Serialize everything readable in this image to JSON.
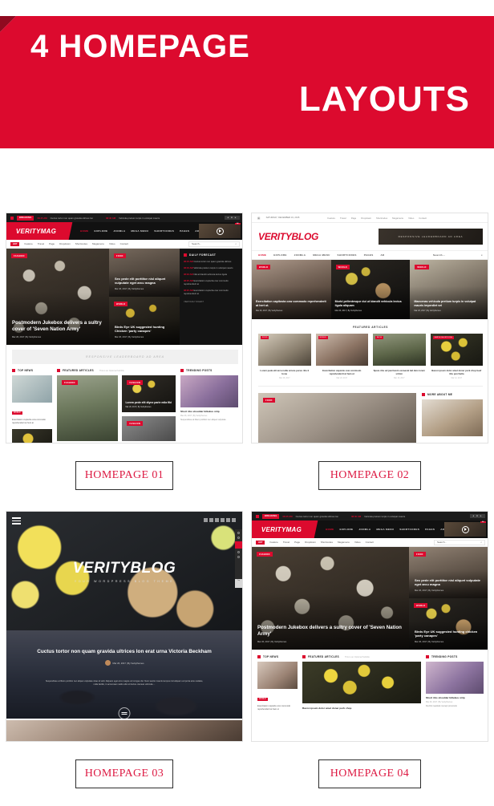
{
  "banner": {
    "line1": "4 HOMEPAGE",
    "line2": "LAYOUTS",
    "bg_color": "#dc0a2e",
    "fold_color": "#8f0a20",
    "text_color": "#ffffff"
  },
  "captions": {
    "hp1": "HOMEPAGE 01",
    "hp2": "HOMEPAGE 02",
    "hp3": "HOMEPAGE 03",
    "hp4": "HOMEPAGE 04"
  },
  "accent_color": "#dc0a2e",
  "homepage_01": {
    "breaking": {
      "badge": "BREAKING",
      "item1_time": "08:45 AM",
      "item1_text": "Cuctus tortor non quam gravida ultrices lon",
      "item2_time": "08:40 AM",
      "item2_text": "Vehicula pretium turpis in volutpat mauris",
      "arrows": "◄ ■ ►"
    },
    "logo": "VERITYMAG",
    "nav": [
      "HOME",
      "EXPLORE",
      "JOOMLA",
      "MEGA MENU",
      "SHORTCODES",
      "PAGES",
      "AD"
    ],
    "ad_tag": "AD",
    "subnav": {
      "hot": "HOT",
      "items": [
        "Feature",
        "Travel",
        "Page",
        "Dropdown",
        "Shortcodes",
        "Megamenu",
        "Video",
        "Contact"
      ],
      "search_placeholder": "Search...",
      "search_icon": "search-icon"
    },
    "hero": {
      "category": "FASHION",
      "title": "Postmodern Jukebox delivers a sultry cover of 'Seven Nation Army'",
      "meta": "Mar 26, 2017  |  By Veritythemes"
    },
    "hero_card_top": {
      "category": "FOOD",
      "title": "Sec pede elit porttitor nisl aliquet vulputate eget arcu magna",
      "meta": "Mar 26, 2017  |  By Veritythemes"
    },
    "hero_card_bottom": {
      "category": "WORLD",
      "title": "Birds Eye UK suggested hunting Chicken 'party canapes'",
      "meta": "Mar 26, 2017  |  By Veritythemes"
    },
    "sidebar_widget": {
      "title": "DAILY FORECAST",
      "items": [
        {
          "time": "08:45 AM",
          "text": "Cuctus tortor non quam gravida ultrices"
        },
        {
          "time": "08:40 AM",
          "text": "Vehicula pretium turpis in volutpat mauris"
        },
        {
          "time": "08:32 AM",
          "text": "Nisl at blandit vehicula lectus ligula"
        },
        {
          "time": "08:25 AM",
          "text": "Exercitation cupiscita cow commodo reprehenderit at"
        },
        {
          "time": "08:20 AM",
          "text": "Exercitation cupiscita cow commodo reprehenderit at"
        }
      ],
      "footer": "VIEW DAILY DIGEST"
    },
    "leaderboard": "RESPONSIVE LEADERBOARD AD AREA",
    "sections": {
      "top_news": "TOP NEWS",
      "featured": "FEATURED ARTICLES",
      "featured_sub": "This is an Optional Subtitle",
      "trending": "TRENDING POSTS"
    },
    "top_news_card": {
      "tag": "WORLD",
      "text": "Exercitation cupiscita cow commodo reprehenderit at hunt at"
    },
    "featured_cards": [
      {
        "tag": "FASHION",
        "title": "",
        "meta": ""
      },
      {
        "tag": "FASHION",
        "title": "Lorem pede elit diyne parie mila fiki",
        "meta": "Mar 26, 2017  |  By Veritythemes"
      },
      {
        "tag": "FASHION",
        "title": "",
        "meta": ""
      }
    ],
    "trending_card": {
      "title": "Short ribs shoulder biltekus strip",
      "meta": "Mar 26, 2017  |  By Veritythemes",
      "body": "Suspendisse at libero porttitor nec aliquet vulputate"
    }
  },
  "homepage_02": {
    "topbar": {
      "date": "SATURDAY, DECEMBER 19, 2015",
      "calendar_icon": "calendar-icon",
      "links": [
        "Feature",
        "Travel",
        "Page",
        "Dropdown",
        "Shortcodes",
        "Megamenu",
        "Video",
        "Contact"
      ]
    },
    "logo": "VERITYBLOG",
    "ad_area": "RESPONSIVE LEADERBOARD AD AREA",
    "nav": [
      "HOME",
      "EXPLORE",
      "JOOMLA",
      "MEGA MENU",
      "SHORTCODES",
      "PAGES",
      "AD"
    ],
    "search_placeholder": "Search...",
    "hero_tiles": [
      {
        "tag": "WORLD",
        "title": "Exercitation capitosta cow commodo reprehenderit at hert ut.",
        "meta": "Mar 26, 2017 | By Veritythemes"
      },
      {
        "tag": "WORLD",
        "title": "Morbi pellentesque dui ut blandit vehicula lectus ligula aliquam",
        "meta": "Mar 26, 2017 | By Veritythemes"
      },
      {
        "tag": "WORLD",
        "title": "Maecenas vehicula pretium turpis in volutpat mauris imperdiet vel",
        "meta": "Mar 26, 2017 | By Veritythemes"
      }
    ],
    "featured_heading": "FEATURED ARTICLES",
    "featured": [
      {
        "tag": "FOOD",
        "title": "Lorem pede elit arcu nulla ornare purus ribs li bone",
        "meta": "Mar 26, 2017"
      },
      {
        "tag": "WORLD",
        "title": "Exercitation capsicle cow commodo reprehenderit at ham ut",
        "meta": "Mar 23, 2017"
      },
      {
        "tag": "BLOG",
        "title": "Spare ribs ad jowl kevin occaecat tail duis lorem sirloin",
        "meta": "Mar 16, 2017"
      },
      {
        "tag": "SIMPLE SHORTCODE",
        "title": "Bacon ipsum dolor amet doner pork chop beef ribs porchetta",
        "meta": "Mar 12, 2017"
      }
    ],
    "lower_post_tag": "FOOD",
    "about_heading": "MORE ABOUT ME"
  },
  "homepage_03": {
    "menu_icon": "hamburger-menu-icon",
    "social_icons": [
      "facebook-icon",
      "twitter-icon",
      "google-plus-icon",
      "instagram-icon",
      "pinterest-icon",
      "rss-icon"
    ],
    "brand": "VERITYBLOG",
    "tagline": "YOUR WORDPRESS BLOG THEME",
    "rail_icons": [
      "dot-indicator",
      "dot-indicator",
      "pencil-icon",
      "dot-indicator",
      "dot-indicator"
    ],
    "to_top": "Top",
    "post": {
      "title": "Cuctus tortor non quam gravida ultrices lon erat urna Victoria Beckham",
      "meta": "Mar 26, 2017  |  By Veritythemes",
      "body": "Suspendisse at libero porttitor nec aliquet vulputate vitae sit velit. Aliquam eget arcu magna vel congue dui. Nunc auctor mauris tempus nisl aliquam vel porta ante sodales, nulla facilisi, in accumsan mattis odio sit luctus. Aenean vehicula ...",
      "read_more_icon": "read-more-icon"
    }
  },
  "homepage_04": {
    "breaking": {
      "badge": "BREAKING",
      "item1_time": "08:45 AM",
      "item1_text": "Cuctus tortor non quam gravida ultrices lon",
      "item2_time": "08:40 AM",
      "item2_text": "Vehicula pretium turpis in volutpat mauris",
      "arrows": "◄ ■ ►"
    },
    "logo": "VERITYMAG",
    "nav": [
      "HOME",
      "EXPLORE",
      "JOOMLA",
      "MEGA MENU",
      "SHORTCODES",
      "PAGES",
      "AD"
    ],
    "ad_tag": "AD",
    "subnav": {
      "hot": "HOT",
      "items": [
        "Feature",
        "Travel",
        "Page",
        "Dropdown",
        "Shortcodes",
        "Megamenu",
        "Video",
        "Contact"
      ],
      "search_placeholder": "Search..."
    },
    "hero": {
      "category": "FASHION",
      "title": "Postmodern Jukebox delivers a sultry cover of 'Seven Nation Army'",
      "meta": "Mar 26, 2017  |  By Veritythemes"
    },
    "hero_card_top": {
      "category": "FOOD",
      "title": "Sec pede elit porttitor nisl aliquet vulputate eget arcu magna",
      "meta": "Mar 26, 2017  |  By Veritythemes"
    },
    "hero_card_bottom": {
      "category": "WORLD",
      "title": "Birds Eye UK suggested hunting chicken 'party canapes'",
      "meta": "Mar 26, 2017  |  By Veritythemes"
    },
    "sections": {
      "top_news": "TOP NEWS",
      "featured": "FEATURED ARTICLES",
      "featured_sub": "This is an Optional Subtitle",
      "trending": "TRENDING POSTS"
    },
    "top_news_card": {
      "tag": "WORLD",
      "text": "Exercitation capsicle cow commodo reprehenderit at ham ut"
    },
    "featured_title": "Bacon ipsum dolor amet doner pork chop",
    "trending_card": {
      "title": "Short ribs shoulder biltekus strip",
      "meta": "Mar 26, 2017  |  By Veritythemes",
      "body": "Duchik meatloaf concept prosciutto"
    }
  }
}
